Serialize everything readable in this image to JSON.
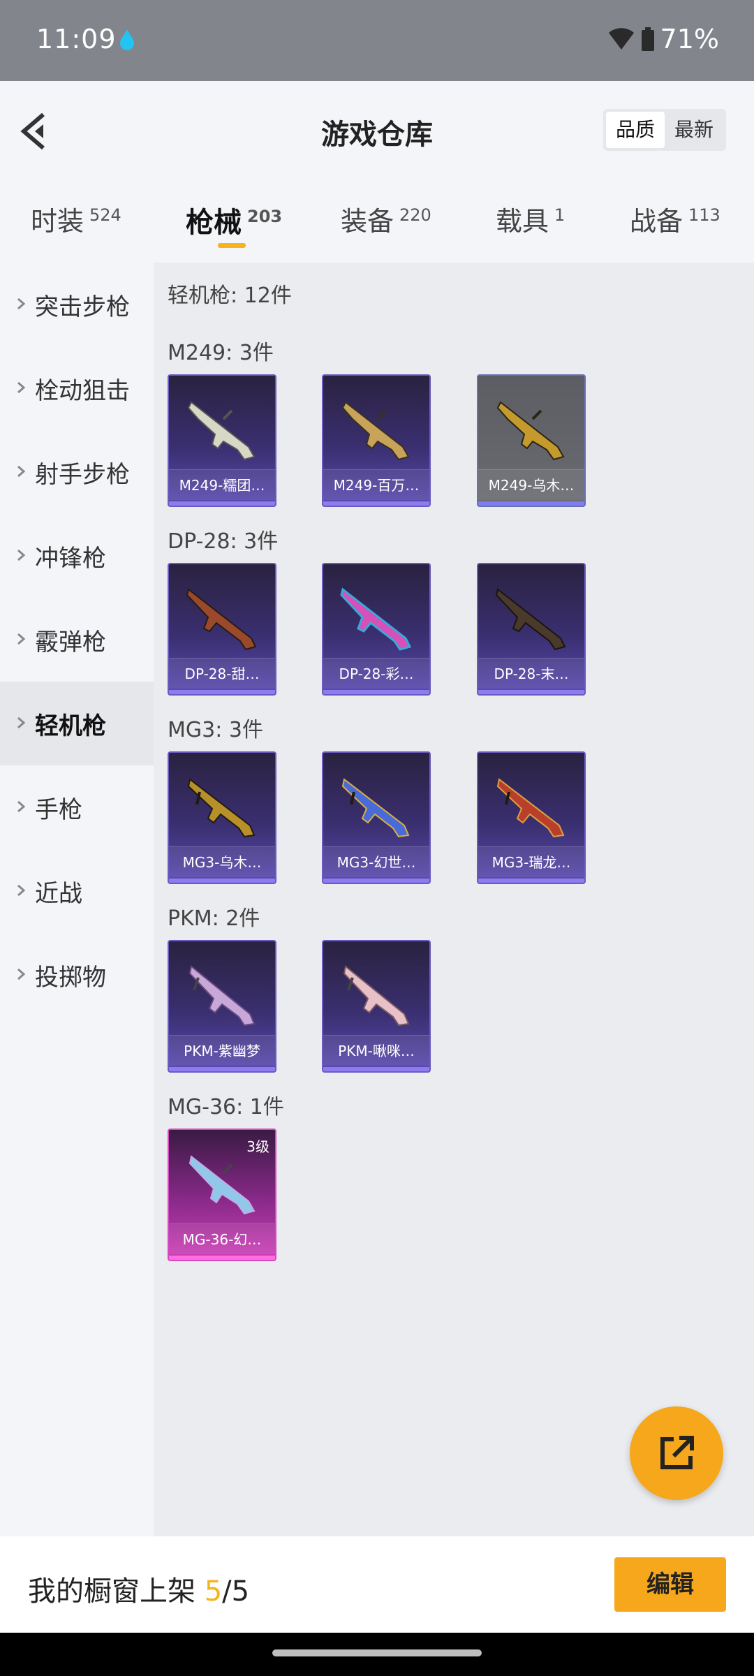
{
  "status": {
    "time": "11:09",
    "battery": "71%"
  },
  "header": {
    "title": "游戏仓库",
    "sort_options": [
      "品质",
      "最新"
    ]
  },
  "tabs": [
    {
      "label": "时装",
      "count": "524"
    },
    {
      "label": "枪械",
      "count": "203"
    },
    {
      "label": "装备",
      "count": "220"
    },
    {
      "label": "载具",
      "count": "1"
    },
    {
      "label": "战备",
      "count": "113"
    }
  ],
  "sidebar": {
    "items": [
      "突击步枪",
      "栓动狙击",
      "射手步枪",
      "冲锋枪",
      "霰弹枪",
      "轻机枪",
      "手枪",
      "近战",
      "投掷物"
    ],
    "active": "轻机枪"
  },
  "content": {
    "total": "轻机枪: 12件",
    "groups": [
      {
        "title": "M249: 3件",
        "items": [
          {
            "name": "M249-糯团…",
            "color": "purple"
          },
          {
            "name": "M249-百万…",
            "color": "purple"
          },
          {
            "name": "M249-乌木…",
            "color": "gray"
          }
        ]
      },
      {
        "title": "DP-28: 3件",
        "items": [
          {
            "name": "DP-28-甜…",
            "color": "purple"
          },
          {
            "name": "DP-28-彩…",
            "color": "purple"
          },
          {
            "name": "DP-28-末…",
            "color": "purple"
          }
        ]
      },
      {
        "title": "MG3: 3件",
        "items": [
          {
            "name": "MG3-乌木…",
            "color": "purple"
          },
          {
            "name": "MG3-幻世…",
            "color": "purple"
          },
          {
            "name": "MG3-瑞龙…",
            "color": "purple"
          }
        ]
      },
      {
        "title": "PKM: 2件",
        "items": [
          {
            "name": "PKM-紫幽梦",
            "color": "purple"
          },
          {
            "name": "PKM-啾咪…",
            "color": "purple"
          }
        ]
      },
      {
        "title": "MG-36: 1件",
        "items": [
          {
            "name": "MG-36-幻…",
            "color": "pink",
            "level": "3级"
          }
        ]
      }
    ]
  },
  "bottom": {
    "showcase_label": "我的橱窗上架",
    "showcase_current": "5",
    "showcase_total": "/5",
    "edit_label": "编辑"
  }
}
